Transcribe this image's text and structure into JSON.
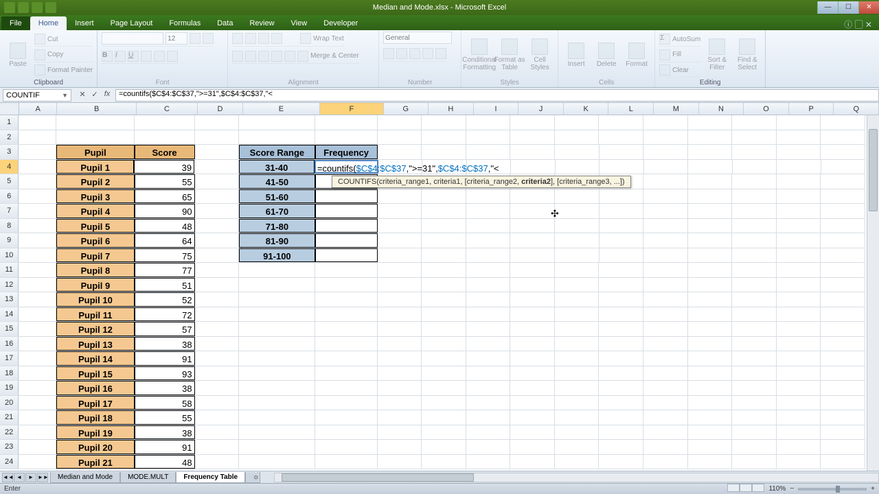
{
  "window": {
    "title": "Median and Mode.xlsx - Microsoft Excel",
    "min": "—",
    "max": "☐",
    "close": "✕",
    "qat": [
      "excel",
      "save",
      "undo",
      "redo"
    ]
  },
  "ribbon_tabs": [
    "File",
    "Home",
    "Insert",
    "Page Layout",
    "Formulas",
    "Data",
    "Review",
    "View",
    "Developer"
  ],
  "active_tab": "Home",
  "ribbon": {
    "clipboard": {
      "label": "Clipboard",
      "paste": "Paste",
      "cut": "Cut",
      "copy": "Copy",
      "fmt": "Format Painter"
    },
    "font": {
      "label": "Font",
      "size": "12"
    },
    "alignment": {
      "label": "Alignment",
      "wrap": "Wrap Text",
      "merge": "Merge & Center"
    },
    "number": {
      "label": "Number",
      "fmt": "General"
    },
    "styles": {
      "label": "Styles",
      "cond": "Conditional Formatting",
      "fmtas": "Format as Table",
      "cell": "Cell Styles"
    },
    "cells": {
      "label": "Cells",
      "insert": "Insert",
      "delete": "Delete",
      "format": "Format"
    },
    "editing": {
      "label": "Editing",
      "autosum": "AutoSum",
      "fill": "Fill",
      "clear": "Clear",
      "sort": "Sort & Filter",
      "find": "Find & Select"
    }
  },
  "namebox": "COUNTIF",
  "formula_display": "=countifs($C$4:$C$37,\">=31\",$C$4:$C$37,\"<",
  "formula_parts": {
    "p1": "=countifs(",
    "p2": "$C$4:$C$37",
    "p3": ",\">=31\",",
    "p4": "$C$4:$C$37",
    "p5": ",\"<"
  },
  "tooltip": {
    "fn": "COUNTIFS",
    "args_pre": "(criteria_range1, criteria1, [criteria_range2, ",
    "args_bold": "criteria2",
    "args_post": "], [criteria_range3, ...])"
  },
  "columns": [
    "A",
    "B",
    "C",
    "D",
    "E",
    "F",
    "G",
    "H",
    "I",
    "J",
    "K",
    "L",
    "M",
    "N",
    "O",
    "P",
    "Q"
  ],
  "col_widths": {
    "A": 56,
    "B": 116,
    "C": 90,
    "D": 66,
    "E": 113,
    "F": 93,
    "default": 66
  },
  "headers": {
    "pupil": "Pupil",
    "score": "Score",
    "range": "Score Range",
    "freq": "Frequency"
  },
  "pupils": [
    {
      "name": "Pupil 1",
      "score": 39
    },
    {
      "name": "Pupil 2",
      "score": 55
    },
    {
      "name": "Pupil 3",
      "score": 65
    },
    {
      "name": "Pupil 4",
      "score": 90
    },
    {
      "name": "Pupil 5",
      "score": 48
    },
    {
      "name": "Pupil 6",
      "score": 64
    },
    {
      "name": "Pupil 7",
      "score": 75
    },
    {
      "name": "Pupil 8",
      "score": 77
    },
    {
      "name": "Pupil 9",
      "score": 51
    },
    {
      "name": "Pupil 10",
      "score": 52
    },
    {
      "name": "Pupil 11",
      "score": 72
    },
    {
      "name": "Pupil 12",
      "score": 57
    },
    {
      "name": "Pupil 13",
      "score": 38
    },
    {
      "name": "Pupil 14",
      "score": 91
    },
    {
      "name": "Pupil 15",
      "score": 93
    },
    {
      "name": "Pupil 16",
      "score": 38
    },
    {
      "name": "Pupil 17",
      "score": 58
    },
    {
      "name": "Pupil 18",
      "score": 55
    },
    {
      "name": "Pupil 19",
      "score": 38
    },
    {
      "name": "Pupil 20",
      "score": 91
    },
    {
      "name": "Pupil 21",
      "score": 48
    }
  ],
  "ranges": [
    "31-40",
    "41-50",
    "51-60",
    "61-70",
    "71-80",
    "81-90",
    "91-100"
  ],
  "sheet_tabs": [
    "Median and Mode",
    "MODE.MULT",
    "Frequency Table"
  ],
  "active_sheet": "Frequency Table",
  "status": {
    "mode": "Enter",
    "zoom": "110%"
  }
}
